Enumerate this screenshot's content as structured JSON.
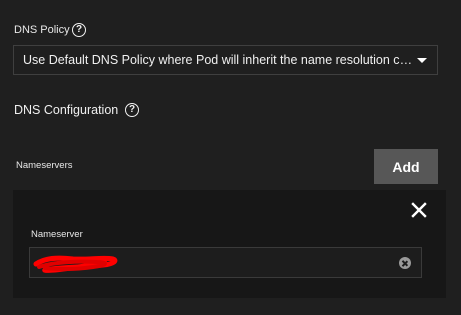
{
  "dns_policy": {
    "label": "DNS Policy",
    "help_glyph": "?",
    "help_icon": "question-circle-icon",
    "selected_value": "Use Default DNS Policy where Pod will inherit the name resolution con...",
    "caret_icon": "caret-down-icon"
  },
  "dns_configuration": {
    "title": "DNS Configuration",
    "help_glyph": "?",
    "help_icon": "question-circle-icon"
  },
  "nameservers": {
    "label": "Nameservers",
    "add_label": "Add",
    "items": [
      {
        "label": "Nameserver",
        "value": "",
        "redacted": true,
        "close_icon": "close-icon",
        "clear_icon": "clear-circle-icon"
      }
    ]
  },
  "colors": {
    "background": "#1f1f1f",
    "card_background": "#171717",
    "button_background": "#575757",
    "border": "#3f3f3f",
    "redaction": "#ff0000"
  }
}
